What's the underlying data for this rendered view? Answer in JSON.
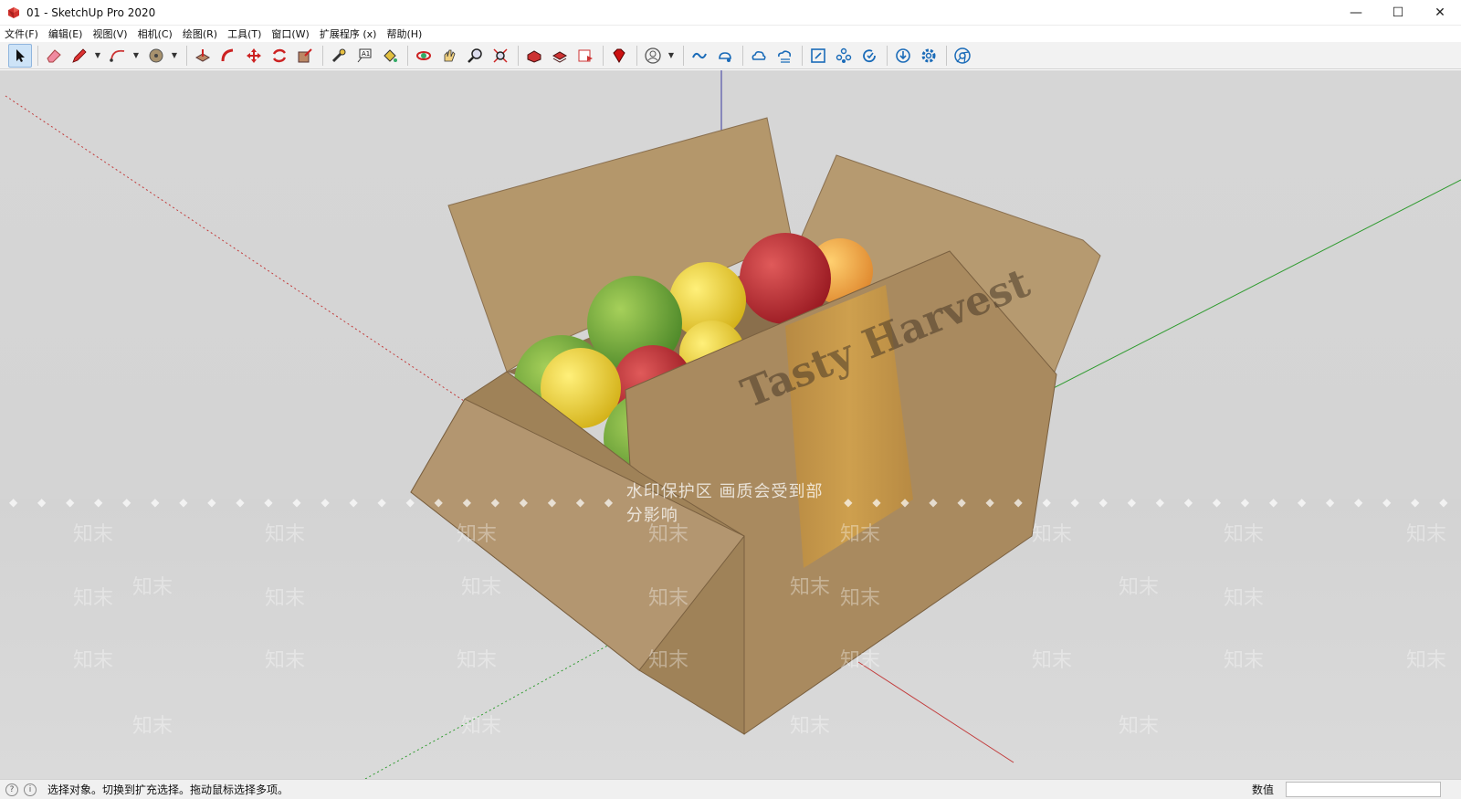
{
  "window": {
    "title": "01 - SketchUp Pro 2020",
    "minimize_glyph": "—",
    "maximize_glyph": "☐",
    "close_glyph": "✕"
  },
  "menu": {
    "items": [
      {
        "label": "文件(F)"
      },
      {
        "label": "编辑(E)"
      },
      {
        "label": "视图(V)"
      },
      {
        "label": "相机(C)"
      },
      {
        "label": "绘图(R)"
      },
      {
        "label": "工具(T)"
      },
      {
        "label": "窗口(W)"
      },
      {
        "label": "扩展程序 (x)"
      },
      {
        "label": "帮助(H)"
      }
    ]
  },
  "toolbar": {
    "tools": [
      "select-icon",
      "eraser-icon",
      "pencil-line-icon",
      "arc-icon",
      "tape-circle-icon",
      "push-pull-icon",
      "follow-me-icon",
      "move-icon",
      "rotate-icon",
      "scale-icon",
      "tape-measure-icon",
      "text-icon",
      "paint-bucket-icon",
      "orbit-icon",
      "pan-icon",
      "zoom-icon",
      "zoom-extents-icon",
      "warehouse-icon",
      "extension-warehouse-icon",
      "layout-icon",
      "ruby-icon",
      "profile-icon",
      "trimble-connect-icon",
      "connect-share-icon",
      "cloud-upload-icon",
      "cloud-sync-icon",
      "fit-view-icon",
      "components-icon",
      "refresh-icon",
      "download-icon",
      "settings-icon",
      "chrome-icon"
    ]
  },
  "viewport": {
    "watermark_banner": "水印保护区   画质会受到部分影响",
    "watermark_dots": "◆ ◆ ◆ ◆ ◆ ◆ ◆ ◆ ◆ ◆ ◆ ◆ ◆ ◆ ◆ ◆ ◆ ◆ ◆ ◆ ◆ ◆ ◆ ◆ ◆ ◆",
    "watermark_text": "知末",
    "box_print": "Tasty Harvest",
    "colors": {
      "axis_red": "#c23b3b",
      "axis_green": "#2f9b2f",
      "axis_blue": "#3a3aa0",
      "cardboard": "#a98a5f",
      "cardboard_light": "#b99a6e",
      "tape": "#c79a45",
      "apple_red": "#b8222e",
      "apple_green": "#7aa83a",
      "apple_yellow": "#e6cf2c"
    }
  },
  "status": {
    "hint": "选择对象。切换到扩充选择。拖动鼠标选择多项。",
    "measurements_label": "数值",
    "measurements_value": ""
  }
}
